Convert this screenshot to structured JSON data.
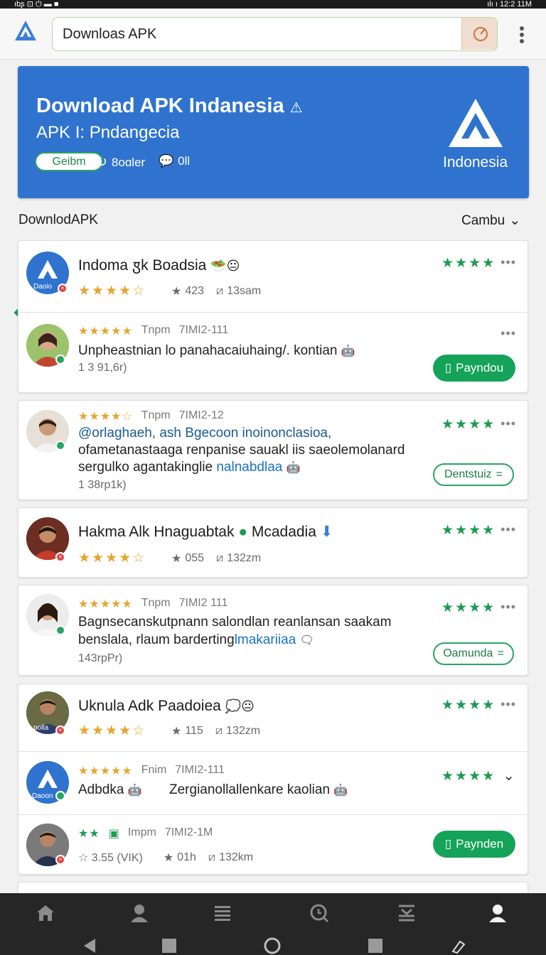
{
  "status": {
    "left": "ıbʂ ⊡ ⏻ ▬ ■",
    "right": "ılı ı 12:2 11M"
  },
  "search": {
    "value": "Downloas APK"
  },
  "hero": {
    "title": "Download APK Indanesia",
    "subtitle": "APK I: Pndangecia",
    "chip": "Geibm",
    "meta1": "8oɑler",
    "meta2": "0ll",
    "country": "Indonesia"
  },
  "section": {
    "title": "DownlodAPK",
    "sort": "Cambu"
  },
  "cards": [
    {
      "title": "Indoma ꟑk Boadsia",
      "rating_stars": "★★★★☆",
      "count": "423",
      "size": "13sam",
      "top_stars": "★★★★",
      "review": {
        "stars": "★★★★★",
        "author": "Tnpm",
        "date": "7IMI2-111",
        "text": "Unpheastnian lo panahacaiuhaing/. kontian",
        "sub": "1 3 91,6r)",
        "button": "Payndou"
      }
    },
    {
      "review": {
        "stars": "★★★★☆",
        "author": "Tnpm",
        "date": "7IMI2-12",
        "line1": "@orlaghaeh, ash Bgecoon inoinonclasioa,",
        "line2": "ofametanastaaga renpanise sauakl iis saeolemolanard",
        "line3a": "sergulko agantakinglie ",
        "line3b": "nalnabdlaa",
        "sub": "1 38rp1k)",
        "button": "Dentstuiz"
      },
      "top_stars": "★★★★"
    },
    {
      "title": "Hakma Alk Hnaguabtak",
      "title2": "Mcadadia",
      "rating_stars": "★★★★☆",
      "count": "055",
      "size": "132zm",
      "top_stars": "★★★★"
    },
    {
      "review": {
        "stars": "★★★★★",
        "author": "Tnpm",
        "date": "7IMI2 111",
        "line1": "Bagnsecanskutpnann salondlan reanlansan saakam",
        "line2a": "benslala, rlaum barderting",
        "line2b": "lmakariiaa",
        "sub": "143rpPr)",
        "button": "Oamunda"
      },
      "top_stars": "★★★★"
    },
    {
      "title": "Uknula Adk Paadoiea",
      "rating_stars": "★★★★☆",
      "count": "115",
      "size": "132zm",
      "top_stars": "★★★★",
      "review": {
        "stars": "★★★★★",
        "author": "Fnim",
        "date": "7IMI2-111",
        "text1": "Adbdka",
        "text2": "Zergianollallenkare kaolian",
        "top_stars": "★★★★"
      },
      "review2": {
        "stars": "★★",
        "author": "Impm",
        "date": "7IMI2-1M",
        "rating": "☆ 3.55 (VIK)",
        "count": "01h",
        "size": "132km",
        "button": "Paynden"
      }
    }
  ],
  "avatar_labels": {
    "a1": "Daoio",
    "a2": "Daoon",
    "a3": "polla"
  }
}
